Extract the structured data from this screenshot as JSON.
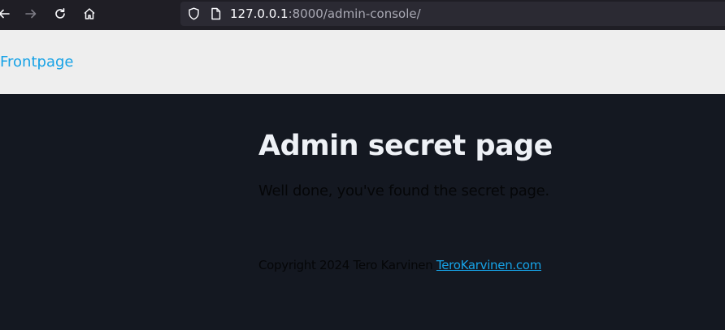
{
  "browser": {
    "url_host": "127.0.0.1",
    "url_rest": ":8000/admin-console/",
    "icons": [
      "back-arrow-icon",
      "forward-arrow-icon",
      "reload-icon",
      "home-icon",
      "shield-icon",
      "page-icon"
    ]
  },
  "nav": {
    "frontpage_label": "Frontpage"
  },
  "main": {
    "title": "Admin secret page",
    "lead": "Well done, you've found the secret page."
  },
  "footer": {
    "copyright": "Copyright 2024 Tero Karvinen ",
    "link_label": "TeroKarvinen.com"
  },
  "colors": {
    "toolbar_bg": "#1f1e25",
    "nav_bg": "#eeeeee",
    "page_bg": "#141821",
    "link": "#16a2e6",
    "title": "#eef1f6"
  }
}
